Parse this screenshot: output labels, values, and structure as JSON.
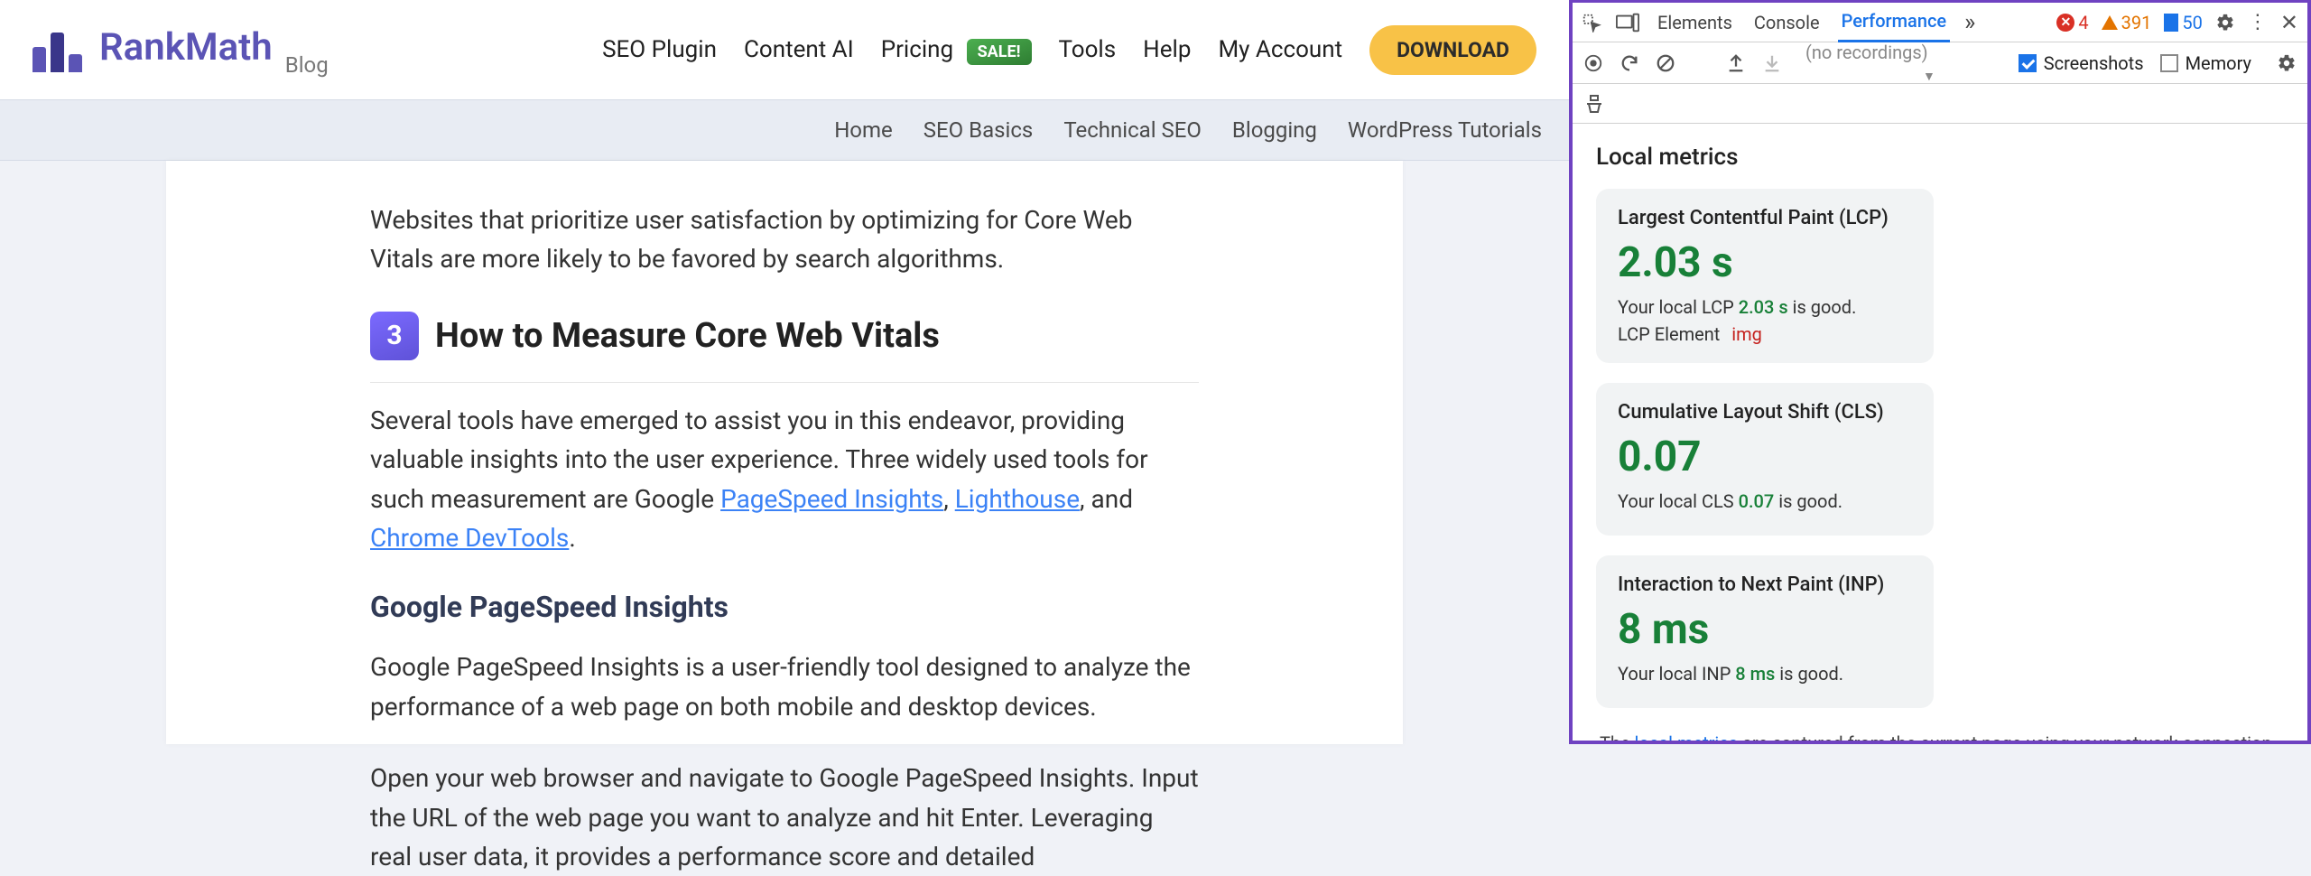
{
  "logo": {
    "name": "RankMath",
    "suffix": "Blog"
  },
  "nav": {
    "items": [
      "SEO Plugin",
      "Content AI",
      "Pricing",
      "Tools",
      "Help",
      "My Account"
    ],
    "sale": "SALE!",
    "download": "DOWNLOAD"
  },
  "subnav": [
    "Home",
    "SEO Basics",
    "Technical SEO",
    "Blogging",
    "WordPress Tutorials"
  ],
  "article": {
    "intro": "Websites that prioritize user satisfaction by optimizing for Core Web Vitals are more likely to be favored by search algorithms.",
    "section_num": "3",
    "section_title": "How to Measure Core Web Vitals",
    "p2_pre": "Several tools have emerged to assist you in this endeavor, providing valuable insights into the user experience. Three widely used tools for such measurement are Google ",
    "link1": "PageSpeed Insights",
    "p2_mid": ", ",
    "link2": "Lighthouse",
    "p2_mid2": ", and ",
    "link3": "Chrome DevTools",
    "p2_end": ".",
    "h3": "Google PageSpeed Insights",
    "p3": "Google PageSpeed Insights is a user-friendly tool designed to analyze the performance of a web page on both mobile and desktop devices.",
    "p4": "Open your web browser and navigate to Google PageSpeed Insights. Input the URL of the web page you want to analyze and hit Enter. Leveraging real user data, it provides a performance score and detailed"
  },
  "devtools": {
    "tabs": {
      "elements": "Elements",
      "console": "Console",
      "performance": "Performance"
    },
    "status": {
      "errors": "4",
      "warnings": "391",
      "info": "50"
    },
    "recordings": "(no recordings)",
    "screenshots": "Screenshots",
    "memory": "Memory",
    "local_metrics_title": "Local metrics",
    "lcp": {
      "title": "Largest Contentful Paint (LCP)",
      "value": "2.03 s",
      "detail_pre": "Your local LCP ",
      "detail_val": "2.03 s",
      "detail_post": " is good.",
      "element_label": "LCP Element",
      "element_tag": "img"
    },
    "cls": {
      "title": "Cumulative Layout Shift (CLS)",
      "value": "0.07",
      "detail_pre": "Your local CLS ",
      "detail_val": "0.07",
      "detail_post": " is good."
    },
    "inp": {
      "title": "Interaction to Next Paint (INP)",
      "value": "8 ms",
      "detail_pre": "Your local INP ",
      "detail_val": "8 ms",
      "detail_post": " is good."
    },
    "footnote_pre": "The ",
    "footnote_link": "local metrics",
    "footnote_post": " are captured from the current page using your network connection and device."
  }
}
